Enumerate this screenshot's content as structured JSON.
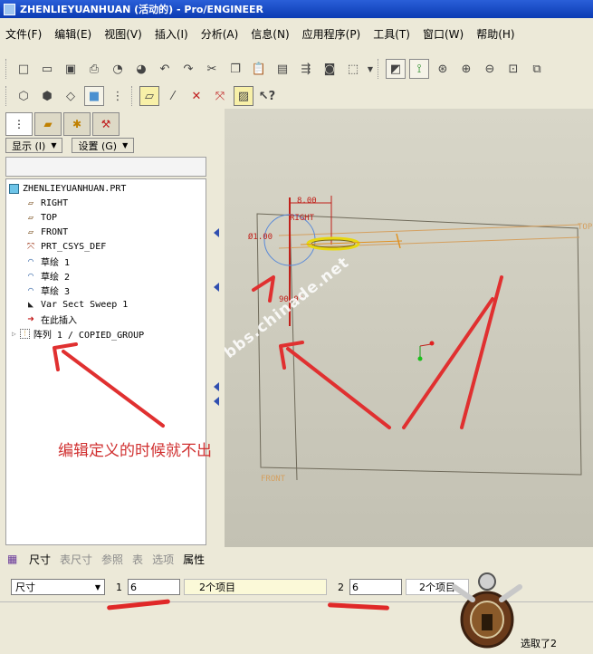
{
  "window": {
    "title": "ZHENLIEYUANHUAN (活动的) - Pro/ENGINEER"
  },
  "menu": [
    "文件(F)",
    "编辑(E)",
    "视图(V)",
    "插入(I)",
    "分析(A)",
    "信息(N)",
    "应用程序(P)",
    "工具(T)",
    "窗口(W)",
    "帮助(H)"
  ],
  "toolbar1_icons": [
    "new-file-icon",
    "open-icon",
    "save-icon",
    "print-icon",
    "send-icon",
    "email-icon",
    "undo-icon",
    "redo-icon",
    "cut-icon",
    "copy-icon",
    "paste-icon",
    "paste-special-icon",
    "regenerate-icon",
    "find-icon",
    "select-box-icon",
    "dropdown-icon",
    "sketch-view-icon",
    "datum-display-icon",
    "spin-center-icon",
    "zoom-in-icon",
    "zoom-out-icon",
    "refit-icon",
    "reorient-icon"
  ],
  "toolbar2_icons": [
    "wireframe-icon",
    "hidden-line-icon",
    "no-hidden-icon",
    "shading-icon",
    "model-tree-icon",
    "datum-planes-icon",
    "datum-axes-icon",
    "datum-points-icon",
    "coordinate-systems-icon",
    "annotation-icon",
    "whats-this-icon"
  ],
  "panel": {
    "display_button": "显示 (I)",
    "settings_button": "设置 (G)",
    "tree": [
      {
        "label": "ZHENLIEYUANHUAN.PRT",
        "icon": "part-icon",
        "level": 0
      },
      {
        "label": "RIGHT",
        "icon": "datum-plane-icon",
        "level": 1
      },
      {
        "label": "TOP",
        "icon": "datum-plane-icon",
        "level": 1
      },
      {
        "label": "FRONT",
        "icon": "datum-plane-icon",
        "level": 1
      },
      {
        "label": "PRT_CSYS_DEF",
        "icon": "csys-icon",
        "level": 1
      },
      {
        "label": "草绘 1",
        "icon": "sketch-icon",
        "level": 1
      },
      {
        "label": "草绘 2",
        "icon": "sketch-icon",
        "level": 1
      },
      {
        "label": "草绘 3",
        "icon": "sketch-icon",
        "level": 1
      },
      {
        "label": "Var Sect Sweep 1",
        "icon": "sweep-icon",
        "level": 1
      },
      {
        "label": "在此插入",
        "icon": "insert-here-icon",
        "level": 1
      },
      {
        "label": "阵列 1 / COPIED_GROUP",
        "icon": "pattern-icon",
        "level": 1
      }
    ]
  },
  "viewport": {
    "watermark": "bbs.chinade.net",
    "annotation": "编辑定义的时候就不出",
    "labels": {
      "dim_8": "8.00",
      "dim_dia": "Ø1.00",
      "dim_angle": "90.0°",
      "right_datum": "RIGHT",
      "top_datum": "TOP",
      "front_datum": "FRONT"
    }
  },
  "dashboard": {
    "tabs": [
      "尺寸",
      "表尺寸",
      "参照",
      "表",
      "选项",
      "属性"
    ],
    "combo_value": "尺寸",
    "index1": "1",
    "value1": "6",
    "items1": "2个项目",
    "index2": "2",
    "value2": "6",
    "items2": "2个项目",
    "status": "选取了2"
  },
  "colors": {
    "title_bar": "#1c4bc4",
    "dimension": "#c0201a",
    "datum": "#d4a060",
    "annotation": "#d03030"
  }
}
